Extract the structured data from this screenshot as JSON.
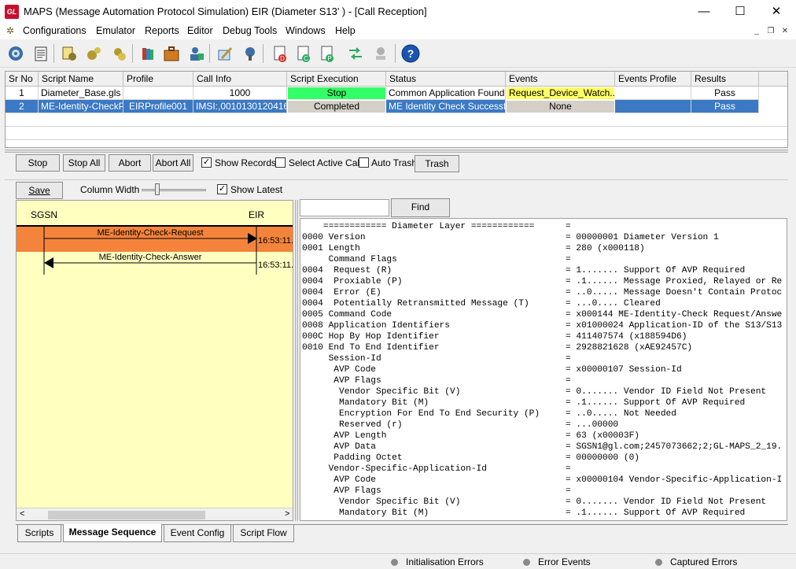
{
  "window": {
    "app_icon_text": "GL",
    "title": "MAPS (Message Automation Protocol Simulation) EIR (Diameter S13' ) - [Call Reception]",
    "minimize": "—",
    "maximize": "☐",
    "close": "✕"
  },
  "menu": {
    "items": [
      "Configurations",
      "Emulator",
      "Reports",
      "Editor",
      "Debug Tools",
      "Windows",
      "Help"
    ],
    "mdi_min": "_",
    "mdi_restore": "❐",
    "mdi_close": "✕"
  },
  "grid": {
    "headers": [
      "Sr No",
      "Script Name",
      "Profile",
      "Call Info",
      "Script Execution",
      "Status",
      "Events",
      "Events Profile",
      "Results"
    ],
    "rows": [
      {
        "sr": "1",
        "script": "Diameter_Base.gls",
        "profile": "",
        "call_info": "1000",
        "execution": "Stop",
        "status": "Common Application Found",
        "events": "Request_Device_Watch...",
        "events_profile": "",
        "results": "Pass"
      },
      {
        "sr": "2",
        "script": "ME-Identity-CheckPr...",
        "profile": "EIRProfile001",
        "call_info": "IMSI:,0010130120416...",
        "execution": "Completed",
        "status": "ME Identity Check Successful",
        "events": "None",
        "events_profile": "",
        "results": "Pass"
      }
    ],
    "colors": {
      "stop_green": "#33ff66",
      "events_yellow": "#ffff66",
      "selected_blue": "#3b79c4",
      "completed_gray": "#d4d0c8"
    }
  },
  "controls": {
    "stop": "Stop",
    "stop_all": "Stop All",
    "abort": "Abort",
    "abort_all": "Abort All",
    "show_records": "Show Records",
    "show_records_checked": "✓",
    "select_active_call": "Select Active Call",
    "auto_trash": "Auto Trash",
    "trash": "Trash",
    "save": "Save",
    "column_width": "Column Width",
    "show_latest": "Show Latest",
    "show_latest_checked": "✓",
    "find": "Find"
  },
  "sequence": {
    "left_node": "SGSN",
    "right_node": "EIR",
    "messages": [
      {
        "label": "ME-Identity-Check-Request",
        "time": "16:53:11.",
        "highlight_color": "#f4843c"
      },
      {
        "label": "ME-Identity-Check-Answer",
        "time": "16:53:11."
      }
    ],
    "scroll_left": "<",
    "scroll_right": ">"
  },
  "decode": {
    "lines": [
      [
        "    ============ Diameter Layer ============",
        "="
      ],
      [
        "0000 Version",
        "= 00000001 Diameter Version 1"
      ],
      [
        "0001 Length",
        "= 280 (x000118)"
      ],
      [
        "     Command Flags",
        "="
      ],
      [
        "0004  Request (R)",
        "= 1....... Support Of AVP Required"
      ],
      [
        "0004  Proxiable (P)",
        "= .1...... Message Proxied, Relayed or Re"
      ],
      [
        "0004  Error (E)",
        "= ..0..... Message Doesn't Contain Protoc"
      ],
      [
        "0004  Potentially Retransmitted Message (T)",
        "= ...0.... Cleared"
      ],
      [
        "0005 Command Code",
        "= x000144 ME-Identity-Check Request/Answe"
      ],
      [
        "0008 Application Identifiers",
        "= x01000024 Application-ID of the S13/S13"
      ],
      [
        "000C Hop By Hop Identifier",
        "= 411407574 (x188594D6)"
      ],
      [
        "0010 End To End Identifier",
        "= 2928821628 (xAE92457C)"
      ],
      [
        "     Session-Id",
        "="
      ],
      [
        "      AVP Code",
        "= x00000107 Session-Id"
      ],
      [
        "      AVP Flags",
        "="
      ],
      [
        "       Vendor Specific Bit (V)",
        "= 0....... Vendor ID Field Not Present"
      ],
      [
        "       Mandatory Bit (M)",
        "= .1...... Support Of AVP Required"
      ],
      [
        "       Encryption For End To End Security (P)",
        "= ..0..... Not Needed"
      ],
      [
        "       Reserved (r)",
        "= ...00000"
      ],
      [
        "      AVP Length",
        "= 63 (x00003F)"
      ],
      [
        "      AVP Data",
        "= SGSN1@gl.com;2457073662;2;GL-MAPS_2_19."
      ],
      [
        "      Padding Octet",
        "= 00000000 (0)"
      ],
      [
        "     Vendor-Specific-Application-Id",
        "="
      ],
      [
        "      AVP Code",
        "= x00000104 Vendor-Specific-Application-I"
      ],
      [
        "      AVP Flags",
        "="
      ],
      [
        "       Vendor Specific Bit (V)",
        "= 0....... Vendor ID Field Not Present"
      ],
      [
        "       Mandatory Bit (M)",
        "= .1...... Support Of AVP Required"
      ]
    ]
  },
  "tabs": [
    "Scripts",
    "Message Sequence",
    "Event Config",
    "Script Flow"
  ],
  "status_bar": [
    "Initialisation Errors",
    "Error Events",
    "Captured Errors"
  ]
}
